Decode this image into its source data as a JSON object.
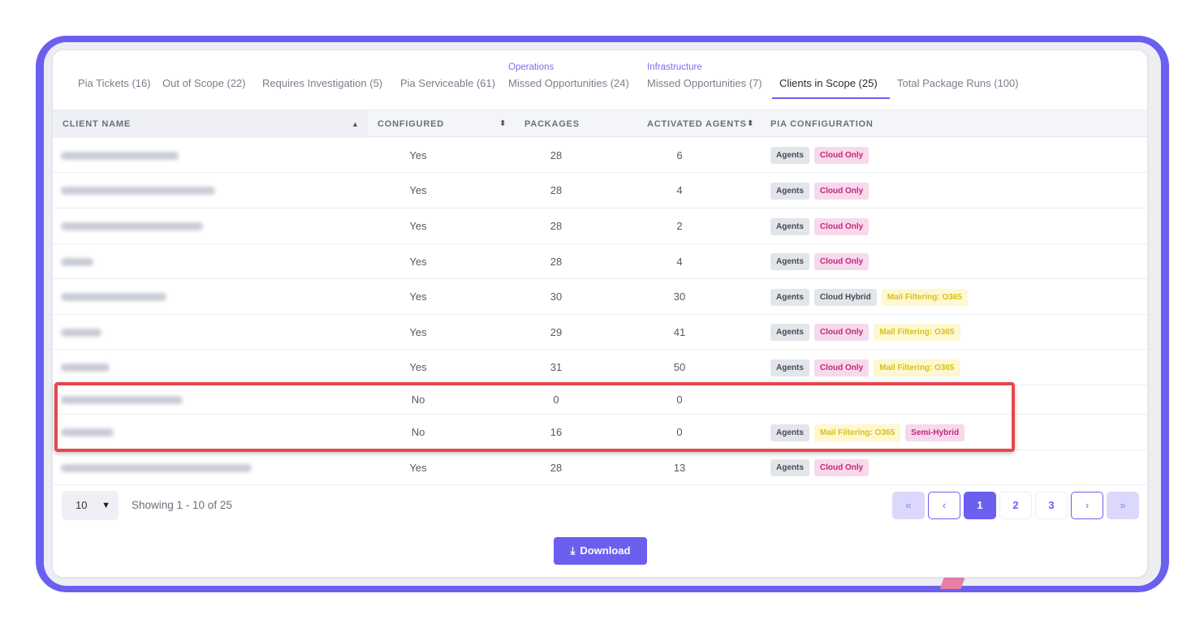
{
  "tabs": [
    {
      "label": "Pia Tickets (16)",
      "sub": ""
    },
    {
      "label": "Out of Scope (22)",
      "sub": ""
    },
    {
      "label": "Requires Investigation (5)",
      "sub": ""
    },
    {
      "label": "Pia Serviceable (61)",
      "sub": ""
    },
    {
      "label": "Missed Opportunities (24)",
      "sub": "Operations"
    },
    {
      "label": "Missed Opportunities (7)",
      "sub": "Infrastructure"
    },
    {
      "label": "Clients in Scope (25)",
      "sub": ""
    },
    {
      "label": "Total Package Runs (100)",
      "sub": ""
    }
  ],
  "active_tab": "Clients in Scope (25)",
  "table": {
    "headers": {
      "client_name": "CLIENT NAME",
      "configured": "CONFIGURED",
      "packages": "PACKAGES",
      "activated_agents": "ACTIVATED AGENTS",
      "pia_configuration": "PIA CONFIGURATION"
    },
    "rows": [
      {
        "configured": "Yes",
        "packages": "28",
        "agents": "6",
        "tags": [
          "Agents",
          "Cloud Only"
        ]
      },
      {
        "configured": "Yes",
        "packages": "28",
        "agents": "4",
        "tags": [
          "Agents",
          "Cloud Only"
        ]
      },
      {
        "configured": "Yes",
        "packages": "28",
        "agents": "2",
        "tags": [
          "Agents",
          "Cloud Only"
        ]
      },
      {
        "configured": "Yes",
        "packages": "28",
        "agents": "4",
        "tags": [
          "Agents",
          "Cloud Only"
        ]
      },
      {
        "configured": "Yes",
        "packages": "30",
        "agents": "30",
        "tags": [
          "Agents",
          "Cloud Hybrid",
          "Mail Filtering: O365"
        ]
      },
      {
        "configured": "Yes",
        "packages": "29",
        "agents": "41",
        "tags": [
          "Agents",
          "Cloud Only",
          "Mail Filtering: O365"
        ]
      },
      {
        "configured": "Yes",
        "packages": "31",
        "agents": "50",
        "tags": [
          "Agents",
          "Cloud Only",
          "Mail Filtering: O365"
        ]
      },
      {
        "configured": "No",
        "packages": "0",
        "agents": "0",
        "tags": []
      },
      {
        "configured": "No",
        "packages": "16",
        "agents": "0",
        "tags": [
          "Agents",
          "Mail Filtering: O365",
          "Semi-Hybrid"
        ]
      },
      {
        "configured": "Yes",
        "packages": "28",
        "agents": "13",
        "tags": [
          "Agents",
          "Cloud Only"
        ]
      }
    ]
  },
  "footer": {
    "page_size": "10",
    "showing": "Showing 1 - 10 of 25",
    "pages": [
      "1",
      "2",
      "3"
    ],
    "current_page": "1",
    "download_label": "Download"
  },
  "colors": {
    "accent": "#6b5ff0",
    "highlight": "#e5484d"
  }
}
